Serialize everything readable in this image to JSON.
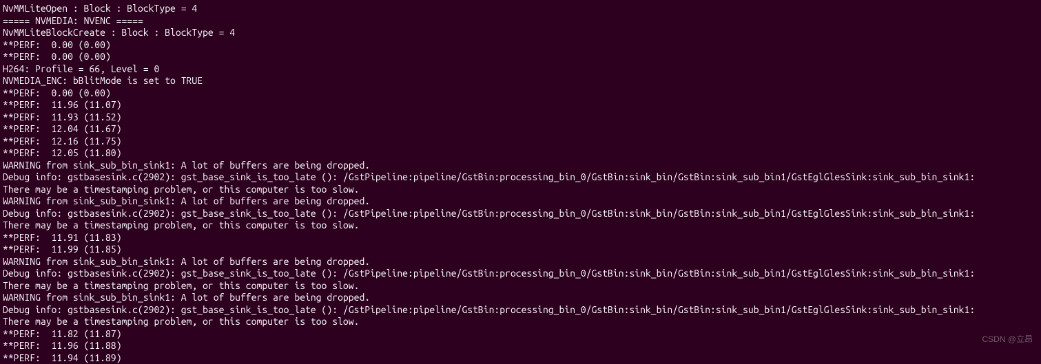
{
  "terminal": {
    "lines": [
      "NvMMLiteOpen : Block : BlockType = 4",
      "===== NVMEDIA: NVENC =====",
      "NvMMLiteBlockCreate : Block : BlockType = 4",
      "**PERF:  0.00 (0.00)",
      "**PERF:  0.00 (0.00)",
      "H264: Profile = 66, Level = 0",
      "NVMEDIA_ENC: bBlitMode is set to TRUE",
      "**PERF:  0.00 (0.00)",
      "**PERF:  11.96 (11.07)",
      "**PERF:  11.93 (11.52)",
      "**PERF:  12.04 (11.67)",
      "**PERF:  12.16 (11.75)",
      "**PERF:  12.05 (11.80)",
      "WARNING from sink_sub_bin_sink1: A lot of buffers are being dropped.",
      "Debug info: gstbasesink.c(2902): gst_base_sink_is_too_late (): /GstPipeline:pipeline/GstBin:processing_bin_0/GstBin:sink_bin/GstBin:sink_sub_bin1/GstEglGlesSink:sink_sub_bin_sink1:",
      "There may be a timestamping problem, or this computer is too slow.",
      "WARNING from sink_sub_bin_sink1: A lot of buffers are being dropped.",
      "Debug info: gstbasesink.c(2902): gst_base_sink_is_too_late (): /GstPipeline:pipeline/GstBin:processing_bin_0/GstBin:sink_bin/GstBin:sink_sub_bin1/GstEglGlesSink:sink_sub_bin_sink1:",
      "There may be a timestamping problem, or this computer is too slow.",
      "**PERF:  11.91 (11.83)",
      "**PERF:  11.99 (11.85)",
      "WARNING from sink_sub_bin_sink1: A lot of buffers are being dropped.",
      "Debug info: gstbasesink.c(2902): gst_base_sink_is_too_late (): /GstPipeline:pipeline/GstBin:processing_bin_0/GstBin:sink_bin/GstBin:sink_sub_bin1/GstEglGlesSink:sink_sub_bin_sink1:",
      "There may be a timestamping problem, or this computer is too slow.",
      "WARNING from sink_sub_bin_sink1: A lot of buffers are being dropped.",
      "Debug info: gstbasesink.c(2902): gst_base_sink_is_too_late (): /GstPipeline:pipeline/GstBin:processing_bin_0/GstBin:sink_bin/GstBin:sink_sub_bin1/GstEglGlesSink:sink_sub_bin_sink1:",
      "There may be a timestamping problem, or this computer is too slow.",
      "**PERF:  11.82 (11.87)",
      "**PERF:  11.96 (11.88)",
      "**PERF:  11.94 (11.89)"
    ]
  },
  "watermark": "CSDN @立昂"
}
